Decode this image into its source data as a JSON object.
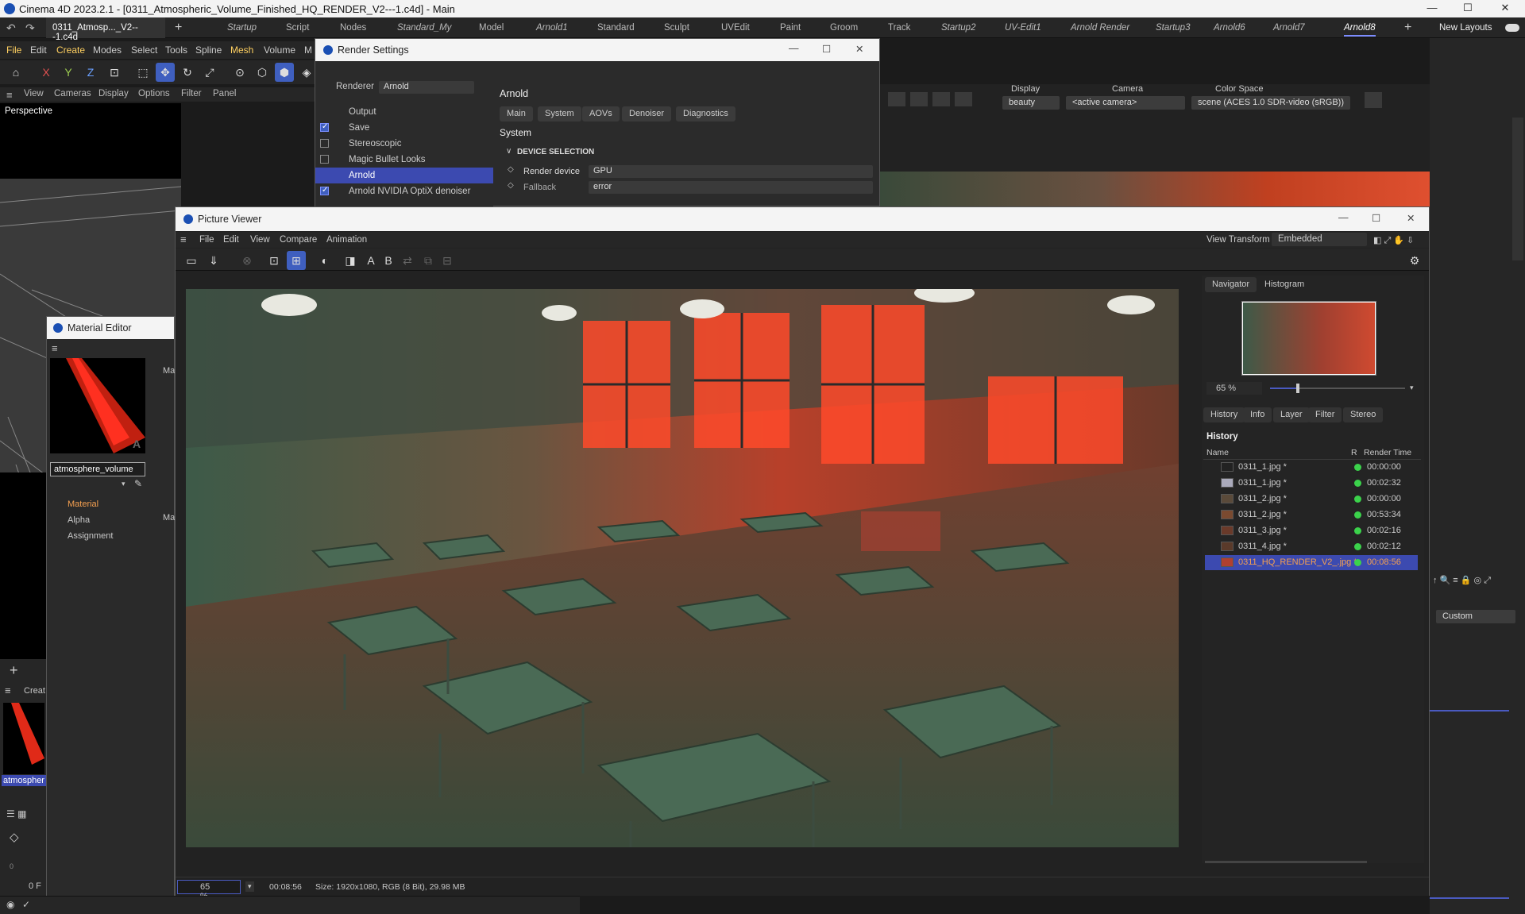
{
  "titlebar": {
    "title": "Cinema 4D 2023.2.1 - [0311_Atmospheric_Volume_Finished_HQ_RENDER_V2---1.c4d] - Main",
    "minimize": "—",
    "maximize": "☐",
    "close": "✕"
  },
  "tabs": {
    "doc_tab": "0311_Atmosp..._V2---1.c4d",
    "layouts": [
      "Startup",
      "Script",
      "Nodes",
      "Standard_My",
      "Model",
      "Arnold1",
      "Standard",
      "Sculpt",
      "UVEdit",
      "Paint",
      "Groom",
      "Track",
      "Startup2",
      "UV-Edit1",
      "Arnold Render",
      "Startup3",
      "Arnold6",
      "Arnold7",
      "Arnold8"
    ],
    "new_layouts": "New Layouts"
  },
  "menubar": [
    "File",
    "Edit",
    "Create",
    "Modes",
    "Select",
    "Tools",
    "Spline",
    "Mesh",
    "Volume",
    "M"
  ],
  "view_menu": [
    "View",
    "Cameras",
    "Display",
    "Options",
    "Filter",
    "Panel"
  ],
  "viewport_label": "Perspective",
  "render_settings": {
    "title": "Render Settings",
    "renderer_label": "Renderer",
    "renderer_value": "Arnold",
    "items": [
      {
        "label": "Output",
        "check": null
      },
      {
        "label": "Save",
        "check": true
      },
      {
        "label": "Stereoscopic",
        "check": false
      },
      {
        "label": "Magic Bullet Looks",
        "check": false
      },
      {
        "label": "Arnold",
        "check": null
      },
      {
        "label": "Arnold NVIDIA OptiX denoiser",
        "check": true
      }
    ],
    "section": "Arnold",
    "tabs": [
      "Main",
      "System",
      "AOVs",
      "Denoiser",
      "Diagnostics"
    ],
    "subtitle": "System",
    "group": "DEVICE SELECTION",
    "render_device_label": "Render device",
    "render_device_value": "GPU",
    "fallback_label": "Fallback",
    "fallback_value": "error"
  },
  "arnold_toolbar": {
    "display_label": "Display",
    "display_value": "beauty",
    "camera_label": "Camera",
    "camera_value": "<active camera>",
    "colorspace_label": "Color Space",
    "colorspace_value": "scene (ACES 1.0 SDR-video (sRGB))"
  },
  "picture_viewer": {
    "title": "Picture Viewer",
    "menu": [
      "File",
      "Edit",
      "View",
      "Compare",
      "Animation"
    ],
    "view_transform_label": "View Transform",
    "view_transform_value": "Embedded",
    "nav_tabs": [
      "Navigator",
      "Histogram"
    ],
    "zoom": "65 %",
    "panel_tabs": [
      "History",
      "Info",
      "Layer",
      "Filter",
      "Stereo"
    ],
    "history_title": "History",
    "col_name": "Name",
    "col_r": "R",
    "col_time": "Render Time",
    "history": [
      {
        "name": "0311_1.jpg *",
        "time": "00:00:00"
      },
      {
        "name": "0311_1.jpg *",
        "time": "00:02:32"
      },
      {
        "name": "0311_2.jpg *",
        "time": "00:00:00"
      },
      {
        "name": "0311_2.jpg *",
        "time": "00:53:34"
      },
      {
        "name": "0311_3.jpg *",
        "time": "00:02:16"
      },
      {
        "name": "0311_4.jpg *",
        "time": "00:02:12"
      },
      {
        "name": "0311_HQ_RENDER_V2_.jpg *",
        "time": "00:08:56"
      }
    ],
    "status_zoom": "65 %",
    "status_time": "00:08:56",
    "status_size": "Size: 1920x1080, RGB (8 Bit), 29.98 MB"
  },
  "material_editor": {
    "title": "Material Editor",
    "name": "atmosphere_volume",
    "channels": [
      "Material",
      "Alpha",
      "Assignment"
    ],
    "side_label": "Ma",
    "side_label2": "Ma"
  },
  "right_panel": {
    "custom": "Custom"
  },
  "bottom": {
    "create": "Creat",
    "material_label": "atmospher",
    "frame": "0 F",
    "frame_start": "0"
  }
}
